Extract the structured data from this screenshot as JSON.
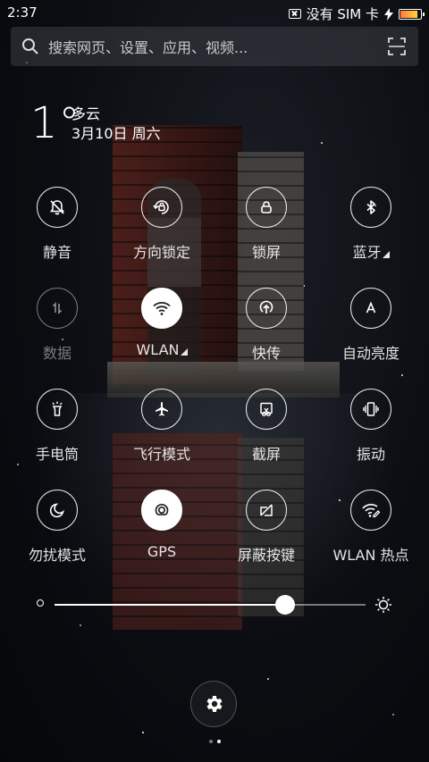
{
  "status_bar": {
    "time": "2:37",
    "carrier": "没有 SIM 卡",
    "battery_level": 0.78
  },
  "search": {
    "placeholder": "搜索网页、设置、应用、视频..."
  },
  "weather": {
    "temperature": "1°",
    "condition": "多云",
    "date": "3月10日 周六"
  },
  "toggles": [
    {
      "label": "静音",
      "icon": "bell-mute-icon",
      "state": "off"
    },
    {
      "label": "方向锁定",
      "icon": "rotation-lock-icon",
      "state": "off"
    },
    {
      "label": "锁屏",
      "icon": "lock-icon",
      "state": "off"
    },
    {
      "label": "蓝牙",
      "icon": "bluetooth-icon",
      "state": "off",
      "has_more": true
    },
    {
      "label": "数据",
      "icon": "mobile-data-icon",
      "state": "disabled"
    },
    {
      "label": "WLAN",
      "icon": "wifi-icon",
      "state": "on",
      "has_more": true
    },
    {
      "label": "快传",
      "icon": "quick-transfer-icon",
      "state": "off"
    },
    {
      "label": "自动亮度",
      "icon": "auto-brightness-icon",
      "state": "off"
    },
    {
      "label": "手电筒",
      "icon": "flashlight-icon",
      "state": "off"
    },
    {
      "label": "飞行模式",
      "icon": "airplane-icon",
      "state": "off"
    },
    {
      "label": "截屏",
      "icon": "screenshot-icon",
      "state": "off"
    },
    {
      "label": "振动",
      "icon": "vibrate-icon",
      "state": "off"
    },
    {
      "label": "勿扰模式",
      "icon": "moon-icon",
      "state": "off"
    },
    {
      "label": "GPS",
      "icon": "gps-icon",
      "state": "on"
    },
    {
      "label": "屏蔽按键",
      "icon": "block-keys-icon",
      "state": "off"
    },
    {
      "label": "WLAN 热点",
      "icon": "hotspot-icon",
      "state": "off"
    }
  ],
  "brightness": {
    "level": 0.74
  },
  "pager": {
    "pages": 2,
    "current": 2
  },
  "colors": {
    "background": "#0b0d12",
    "toggle_on": "#ffffff",
    "battery_fill": "#ffd23a"
  }
}
